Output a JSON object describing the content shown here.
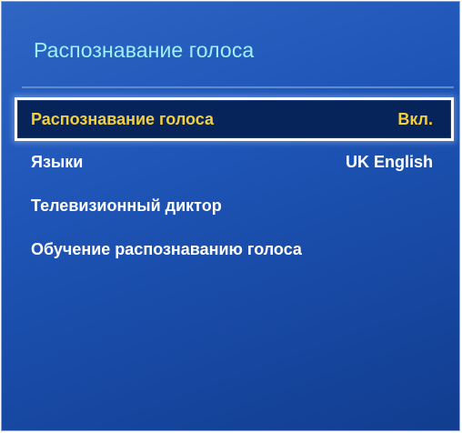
{
  "menu": {
    "title": "Распознавание голоса",
    "items": [
      {
        "label": "Распознавание голоса",
        "value": "Вкл."
      },
      {
        "label": "Языки",
        "value": "UK English"
      },
      {
        "label": "Телевизионный диктор",
        "value": ""
      },
      {
        "label": "Обучение распознаванию голоса",
        "value": ""
      }
    ],
    "selected_index": 0,
    "colors": {
      "background": "#1f56b8",
      "title": "#9ff0ff",
      "selected_text": "#f5cf3a",
      "selected_background": "#07245a",
      "text": "#ffffff"
    }
  }
}
